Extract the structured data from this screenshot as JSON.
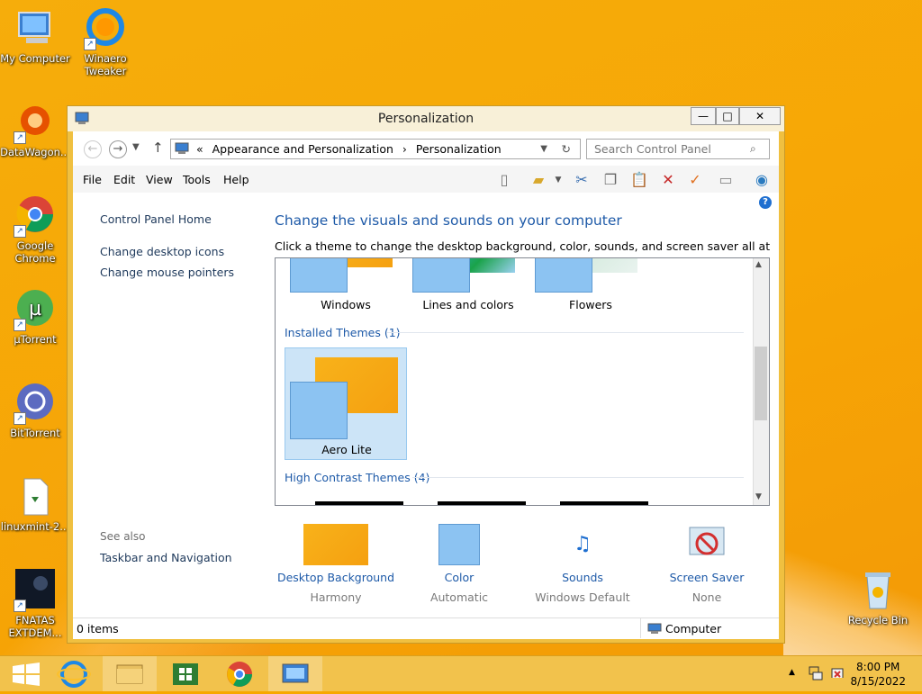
{
  "desktop": {
    "icons": [
      {
        "label": "My Computer"
      },
      {
        "label": "Winaero Tweaker"
      },
      {
        "label": "DataWagon..."
      },
      {
        "label": "Google Chrome"
      },
      {
        "label": "µTorrent"
      },
      {
        "label": "BitTorrent"
      },
      {
        "label": "linuxmint-2..."
      },
      {
        "label": "FNATAS EXTDEM..."
      },
      {
        "label": "Recycle Bin"
      }
    ]
  },
  "window": {
    "title": "Personalization",
    "controls": {
      "minimize": "—",
      "maximize": "□",
      "close": "✕"
    },
    "address": {
      "prefix": "«",
      "crumb1": "Appearance and Personalization",
      "sep": "›",
      "crumb2": "Personalization"
    },
    "search_placeholder": "Search Control Panel",
    "menu": [
      "File",
      "Edit",
      "View",
      "Tools",
      "Help"
    ],
    "left_links": [
      "Control Panel Home",
      "Change desktop icons",
      "Change mouse pointers"
    ],
    "see_also": {
      "heading": "See also",
      "links": [
        "Taskbar and Navigation"
      ]
    },
    "heading": "Change the visuals and sounds on your computer",
    "subheading": "Click a theme to change the desktop background, color, sounds, and screen saver all at once.",
    "themes_top": [
      "Windows",
      "Lines and colors",
      "Flowers"
    ],
    "installed_group": "Installed Themes (1)",
    "installed_themes": [
      "Aero Lite"
    ],
    "high_contrast_group": "High Contrast Themes (4)",
    "bottom": [
      {
        "label": "Desktop Background",
        "value": "Harmony"
      },
      {
        "label": "Color",
        "value": "Automatic"
      },
      {
        "label": "Sounds",
        "value": "Windows Default"
      },
      {
        "label": "Screen Saver",
        "value": "None"
      }
    ],
    "status": {
      "items": "0 items",
      "location": "Computer"
    }
  },
  "taskbar": {
    "time": "8:00 PM",
    "date": "8/15/2022"
  },
  "colors": {
    "accent": "#f0c040",
    "link": "#1e5aa8",
    "desktop": "#f7a800"
  }
}
